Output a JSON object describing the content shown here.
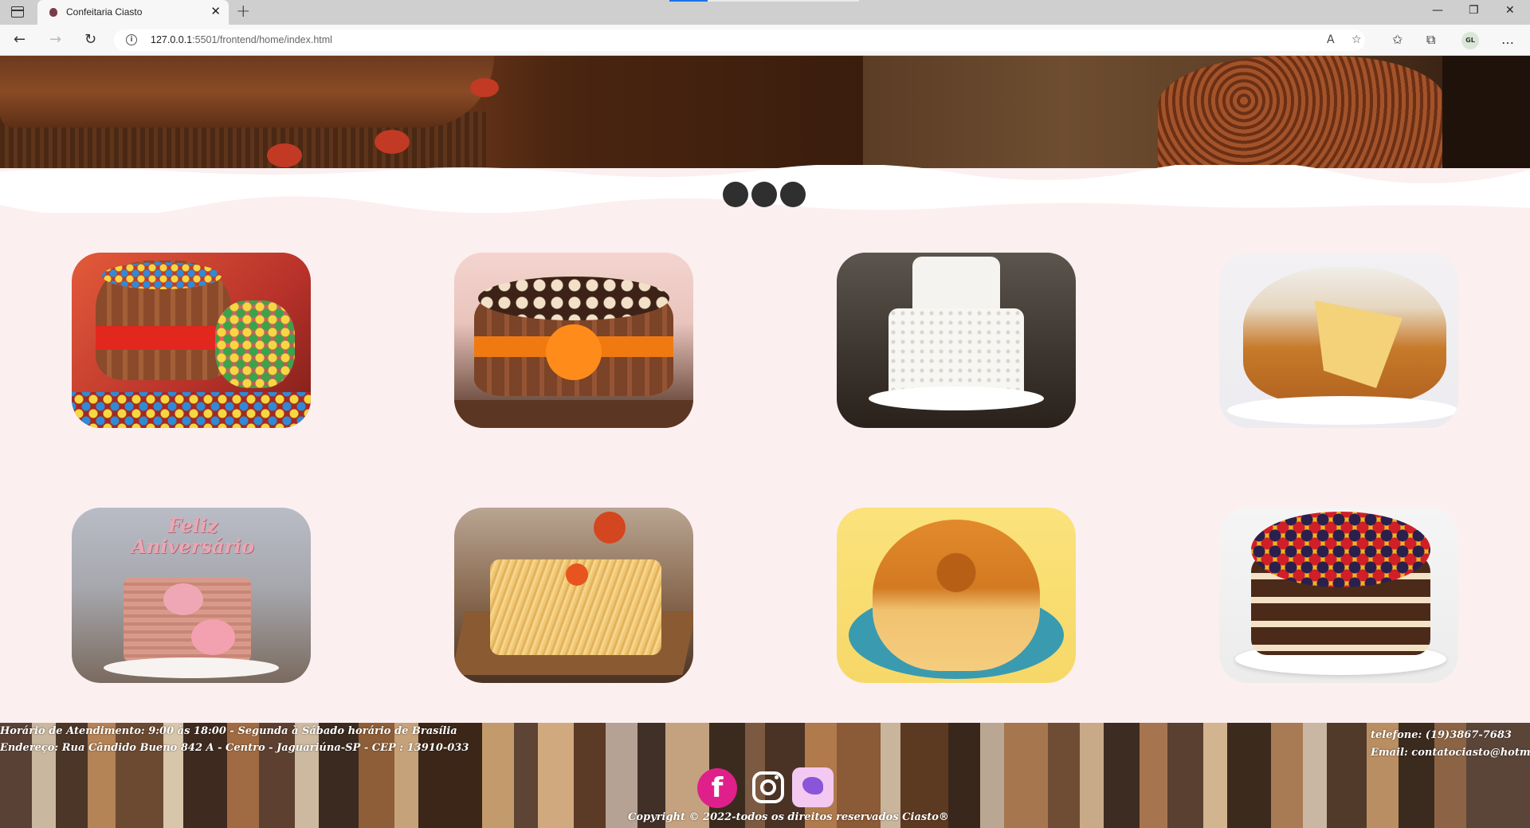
{
  "browser": {
    "tab_title": "Confeitaria Ciasto",
    "tab_close": "✕",
    "new_tab": "+",
    "url_host": "127.0.0.1",
    "url_rest": ":5501/frontend/home/index.html",
    "avatar_initials": "GL",
    "icons": {
      "back": "←",
      "forward": "→",
      "refresh": "↻",
      "info": "i",
      "read_aloud": "A",
      "favorite_add": "☆",
      "favorites": "✩",
      "collections": "⧉",
      "more": "…",
      "minimize": "—",
      "restore": "❐",
      "close": "✕"
    }
  },
  "carousel": {
    "indicators": [
      1,
      2,
      3
    ]
  },
  "gallery": {
    "cards": [
      {
        "name": "kitkat-mm-cake"
      },
      {
        "name": "kitkat-chocolate-ribbon-cake"
      },
      {
        "name": "white-fondant-cake"
      },
      {
        "name": "sponge-cake"
      },
      {
        "name": "feliz-aniversario-rose-cake"
      },
      {
        "name": "potato-straw-savory-cake"
      },
      {
        "name": "bundt-cake"
      },
      {
        "name": "fruit-naked-cake"
      }
    ],
    "topper_text": "Feliz Aniversário"
  },
  "footer": {
    "hours": "Horário de Atendimento: 9:00 às 18:00 - Segunda à Sábado horário de Brasília",
    "address": "Endereço: Rua Cândido Bueno 842 A - Centro - Jaguariúna-SP - CEP : 13910-033",
    "phone": "telefone: (19)3867-7683",
    "email": "Email: contatociasto@hotmail.com",
    "copyright": "Copyright © 2022-todos os direitos reservados Ciasto®",
    "social": {
      "facebook_glyph": "f"
    },
    "colors": {
      "facebook": "#e0208a",
      "twitter_bg": "#f3c9f2",
      "twitter_bird": "#8a55d8"
    }
  }
}
